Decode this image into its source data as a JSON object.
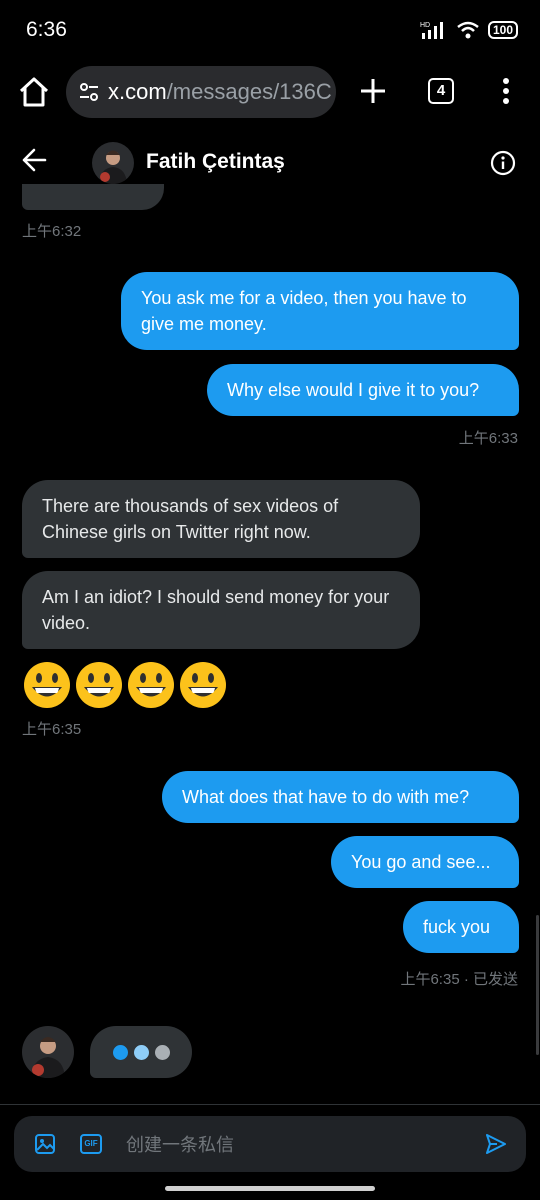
{
  "status_bar": {
    "time": "6:36",
    "network": "HD",
    "battery": "100"
  },
  "browser": {
    "url_host": "x.com",
    "url_path": "/messages/136C",
    "tab_count": "4",
    "icons": {
      "home": "home-icon",
      "site_settings": "tune-icon",
      "new_tab": "plus-icon",
      "tabs": "tab-switcher-icon",
      "menu": "more-vert-icon"
    }
  },
  "chat": {
    "contact_name": "Fatih Çetintaş",
    "icons": {
      "back": "arrow-left-icon",
      "info": "info-icon"
    }
  },
  "messages": [
    {
      "id": "m0",
      "direction": "incoming",
      "text": "",
      "time": "上午6:32"
    },
    {
      "id": "m1",
      "direction": "outgoing",
      "text": "You ask me for a video, then you have to give me money."
    },
    {
      "id": "m2",
      "direction": "outgoing",
      "text": "Why else would I give it to you?",
      "time": "上午6:33"
    },
    {
      "id": "m3",
      "direction": "incoming",
      "text": "There are thousands of sex videos of Chinese girls on Twitter right now."
    },
    {
      "id": "m4",
      "direction": "incoming",
      "text": "Am I an idiot? I should send money for your video."
    },
    {
      "id": "m5",
      "direction": "incoming",
      "text": "😃😃😃😃",
      "time": "上午6:35"
    },
    {
      "id": "m6",
      "direction": "outgoing",
      "text": "What does that have to do with me?"
    },
    {
      "id": "m7",
      "direction": "outgoing",
      "text": "You go and see..."
    },
    {
      "id": "m8",
      "direction": "outgoing",
      "text": "fuck you",
      "time": "上午6:35 · 已发送"
    }
  ],
  "typing_indicator": {
    "visible": true,
    "dot_colors": [
      "#1d9bf0",
      "#8ecdf7",
      "#aab0b5"
    ]
  },
  "composer": {
    "placeholder": "创建一条私信",
    "gif_label": "GIF",
    "icons": {
      "image": "image-icon",
      "gif": "gif-icon",
      "send": "send-icon"
    }
  },
  "colors": {
    "accent": "#1d9bf0",
    "incoming_bubble": "#2f3336",
    "background": "#000000",
    "timestamp": "#71767b"
  }
}
